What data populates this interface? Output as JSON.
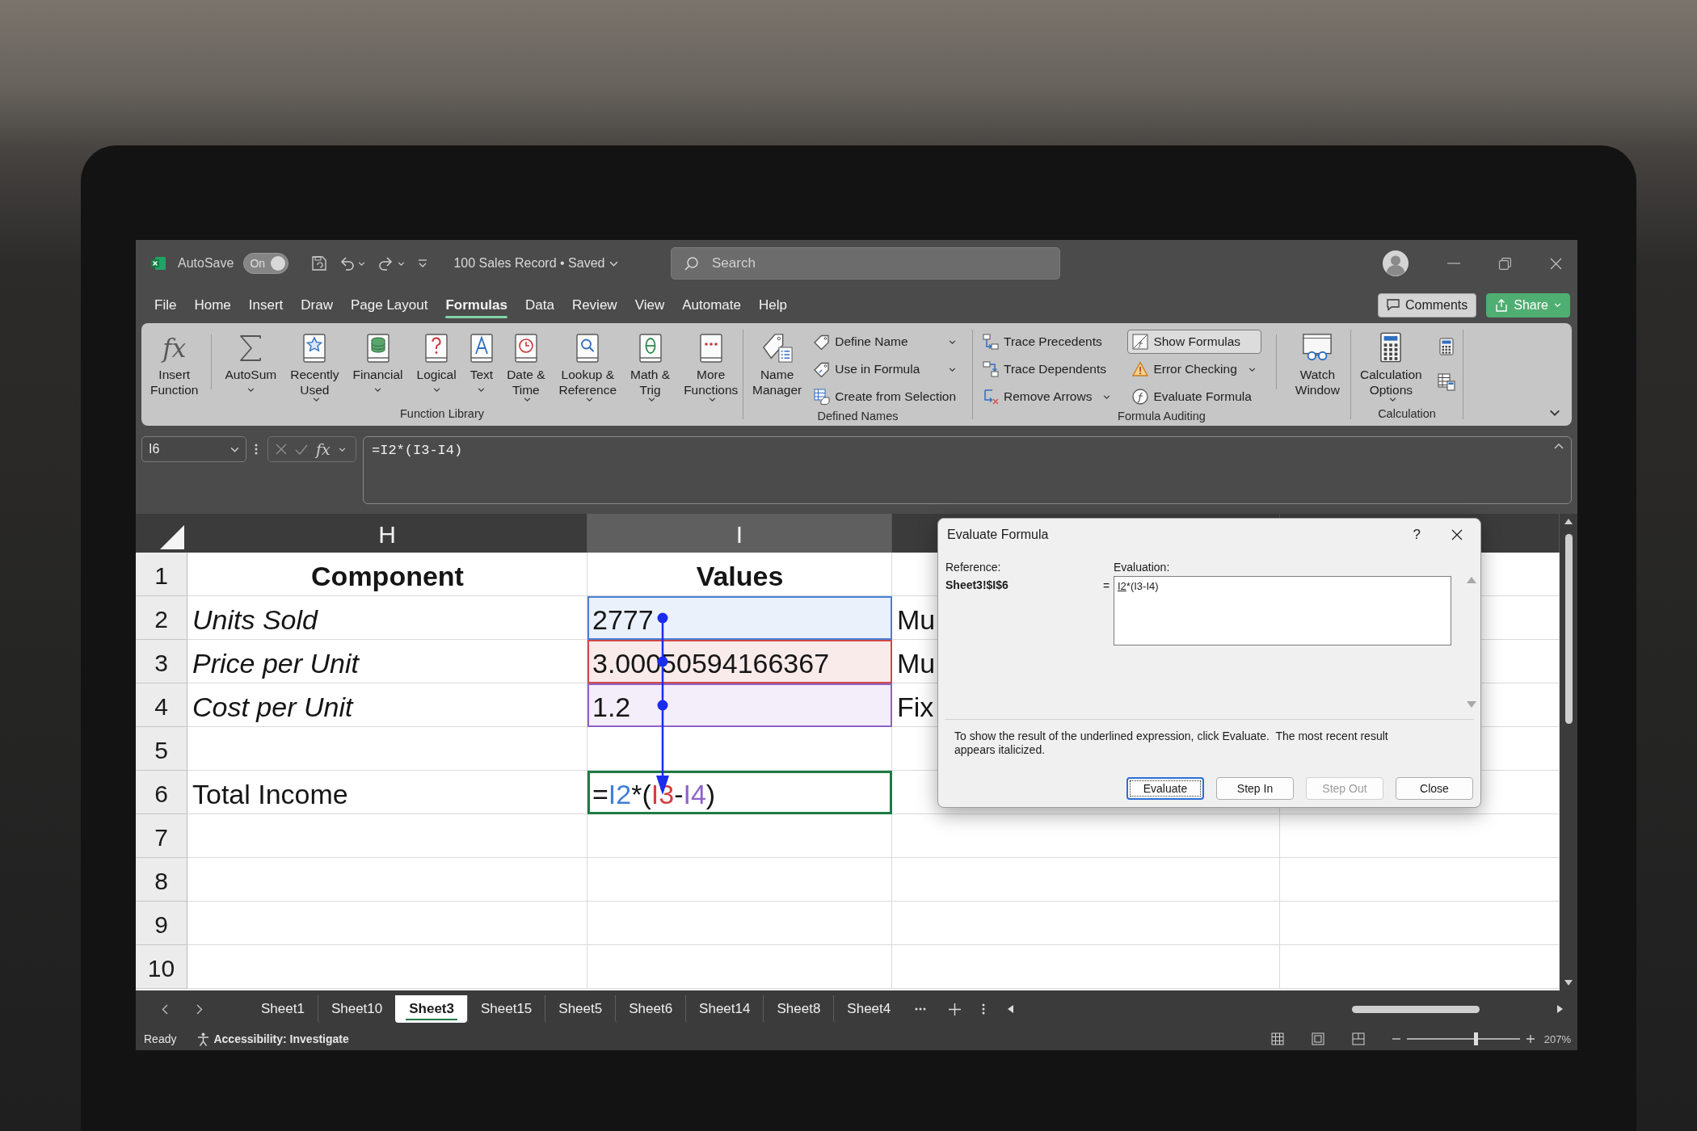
{
  "title_bar": {
    "autosave_label": "AutoSave",
    "autosave_toggle": {
      "label": "On",
      "on": true
    },
    "document_title": "100 Sales Record • Saved",
    "search": {
      "placeholder": "Search"
    }
  },
  "ribbon_tabs": [
    {
      "label": "File",
      "selected": false
    },
    {
      "label": "Home",
      "selected": false
    },
    {
      "label": "Insert",
      "selected": false
    },
    {
      "label": "Draw",
      "selected": false
    },
    {
      "label": "Page Layout",
      "selected": false
    },
    {
      "label": "Formulas",
      "selected": true
    },
    {
      "label": "Data",
      "selected": false
    },
    {
      "label": "Review",
      "selected": false
    },
    {
      "label": "View",
      "selected": false
    },
    {
      "label": "Automate",
      "selected": false
    },
    {
      "label": "Help",
      "selected": false
    }
  ],
  "ribbon_actions": [
    {
      "label": "Comments",
      "kind": "plain"
    },
    {
      "label": "Share",
      "kind": "primary"
    }
  ],
  "ribbon": [
    {
      "label": "Function Library",
      "buttons": [
        {
          "kind": "large",
          "lines": [
            "Insert",
            "Function"
          ],
          "glyph": "fx",
          "dropdown": false,
          "pressed": false
        },
        {
          "kind": "large",
          "lines": [
            "AutoSum"
          ],
          "dropdown": true,
          "pressed": false,
          "divider_before": true
        },
        {
          "kind": "large",
          "lines": [
            "Recently",
            "Used"
          ],
          "dropdown": true,
          "pressed": false
        },
        {
          "kind": "large",
          "lines": [
            "Financial"
          ],
          "dropdown": true,
          "pressed": false
        },
        {
          "kind": "large",
          "lines": [
            "Logical"
          ],
          "dropdown": true,
          "pressed": false
        },
        {
          "kind": "large",
          "lines": [
            "Text"
          ],
          "dropdown": true,
          "pressed": false
        },
        {
          "kind": "large",
          "lines": [
            "Date &",
            "Time"
          ],
          "dropdown": true,
          "pressed": false
        },
        {
          "kind": "large",
          "lines": [
            "Lookup &",
            "Reference"
          ],
          "dropdown": true,
          "pressed": false
        },
        {
          "kind": "large",
          "lines": [
            "Math &",
            "Trig"
          ],
          "dropdown": true,
          "pressed": false
        },
        {
          "kind": "large",
          "lines": [
            "More",
            "Functions"
          ],
          "dropdown": true,
          "pressed": false
        }
      ]
    },
    {
      "label": "Defined Names",
      "buttons": [
        {
          "kind": "large",
          "lines": [
            "Name",
            "Manager"
          ],
          "dropdown": false,
          "pressed": false
        },
        {
          "kind": "small",
          "lines": [
            "Define Name"
          ],
          "dropdown": true,
          "pressed": false
        },
        {
          "kind": "small",
          "lines": [
            "Use in Formula"
          ],
          "dropdown": true,
          "pressed": false
        },
        {
          "kind": "small",
          "lines": [
            "Create from Selection"
          ],
          "dropdown": false,
          "pressed": false
        }
      ]
    },
    {
      "label": "Formula Auditing",
      "buttons": [
        {
          "kind": "small",
          "lines": [
            "Trace Precedents"
          ],
          "dropdown": false,
          "pressed": false
        },
        {
          "kind": "small",
          "lines": [
            "Trace Dependents"
          ],
          "dropdown": false,
          "pressed": false
        },
        {
          "kind": "small",
          "lines": [
            "Remove Arrows"
          ],
          "dropdown": true,
          "pressed": false
        },
        {
          "kind": "small",
          "lines": [
            "Show Formulas"
          ],
          "dropdown": false,
          "pressed": true
        },
        {
          "kind": "small",
          "lines": [
            "Error Checking"
          ],
          "dropdown": true,
          "pressed": false
        },
        {
          "kind": "small",
          "lines": [
            "Evaluate Formula"
          ],
          "dropdown": false,
          "pressed": false
        },
        {
          "kind": "large",
          "lines": [
            "Watch",
            "Window"
          ],
          "dropdown": false,
          "pressed": false,
          "divider_before": true
        }
      ]
    },
    {
      "label": "Calculation",
      "buttons": [
        {
          "kind": "large",
          "lines": [
            "Calculation",
            "Options"
          ],
          "dropdown": true,
          "pressed": false
        },
        {
          "kind": "icon",
          "pressed": false
        },
        {
          "kind": "icon",
          "pressed": false
        }
      ]
    }
  ],
  "formula_bar": {
    "name_box": "I6",
    "glyph": "fx",
    "formula": "=I2*(I3-I4)"
  },
  "sheet": {
    "columns": [
      {
        "label": "H",
        "selected": false
      },
      {
        "label": "I",
        "selected": true
      }
    ],
    "rows": [
      {
        "number": "1",
        "cells": [
          {
            "text": "Component",
            "kind": "heading",
            "selected": false,
            "traced": false
          },
          {
            "text": "Values",
            "kind": "heading",
            "selected": false,
            "traced": false
          }
        ]
      },
      {
        "number": "2",
        "cells": [
          {
            "text": "Units Sold",
            "kind": "label",
            "selected": false,
            "traced": false
          },
          {
            "text": "2777",
            "kind": "value",
            "selected": false,
            "traced": true,
            "color": "#4a7fd4"
          },
          {
            "text": "Mu",
            "kind": "value",
            "selected": false,
            "traced": false
          }
        ]
      },
      {
        "number": "3",
        "cells": [
          {
            "text": "Price per Unit",
            "kind": "label",
            "selected": false,
            "traced": false
          },
          {
            "text": "3.00050594166367",
            "kind": "value",
            "selected": false,
            "traced": true,
            "color": "#d04848"
          },
          {
            "text": "Mu",
            "kind": "value",
            "selected": false,
            "traced": false
          }
        ]
      },
      {
        "number": "4",
        "cells": [
          {
            "text": "Cost per Unit",
            "kind": "label",
            "selected": false,
            "traced": false
          },
          {
            "text": "1.2",
            "kind": "value",
            "selected": false,
            "traced": true,
            "color": "#8e62c8"
          },
          {
            "text": "Fix",
            "kind": "value",
            "selected": false,
            "traced": false
          }
        ]
      },
      {
        "number": "5"
      },
      {
        "number": "6",
        "cells": [
          {
            "text": "Total Income",
            "kind": "value",
            "selected": false,
            "traced": false
          },
          {
            "kind": "formula",
            "parts": [
              {
                "text": "="
              },
              {
                "text": "I2",
                "color": "#3f7fd9"
              },
              {
                "text": "*("
              },
              {
                "text": "I3",
                "color": "#d43f3f"
              },
              {
                "text": "-"
              },
              {
                "text": "I4",
                "color": "#8f63c9"
              },
              {
                "text": ")"
              }
            ],
            "selected": true,
            "traced": false
          }
        ]
      },
      {
        "number": "7"
      },
      {
        "number": "8"
      },
      {
        "number": "9"
      },
      {
        "number": "10"
      }
    ]
  },
  "dialog": {
    "title": "Evaluate Formula",
    "help": "?",
    "reference_label": "Reference:",
    "reference": "Sheet3!$I$6",
    "equals": "=",
    "evaluation_label": "Evaluation:",
    "evaluation": [
      {
        "text": "I2",
        "underlined": true
      },
      {
        "text": "*(I3-I4)",
        "underlined": false
      }
    ],
    "note": "To show the result of the underlined expression, click Evaluate.  The most recent result appears italicized.",
    "buttons": [
      {
        "label": "Evaluate",
        "default": true,
        "disabled": false
      },
      {
        "label": "Step In",
        "default": false,
        "disabled": false
      },
      {
        "label": "Step Out",
        "default": false,
        "disabled": true
      },
      {
        "label": "Close",
        "default": false,
        "disabled": false
      }
    ]
  },
  "sheet_tabs": [
    {
      "label": "Sheet1",
      "selected": false
    },
    {
      "label": "Sheet10",
      "selected": false
    },
    {
      "label": "Sheet3",
      "selected": true
    },
    {
      "label": "Sheet15",
      "selected": false
    },
    {
      "label": "Sheet5",
      "selected": false
    },
    {
      "label": "Sheet6",
      "selected": false
    },
    {
      "label": "Sheet14",
      "selected": false
    },
    {
      "label": "Sheet8",
      "selected": false
    },
    {
      "label": "Sheet4",
      "selected": false
    }
  ],
  "status_bar": {
    "mode": "Ready",
    "accessibility": "Accessibility: Investigate",
    "zoom": {
      "level": 0.62,
      "reading": "207%"
    }
  }
}
